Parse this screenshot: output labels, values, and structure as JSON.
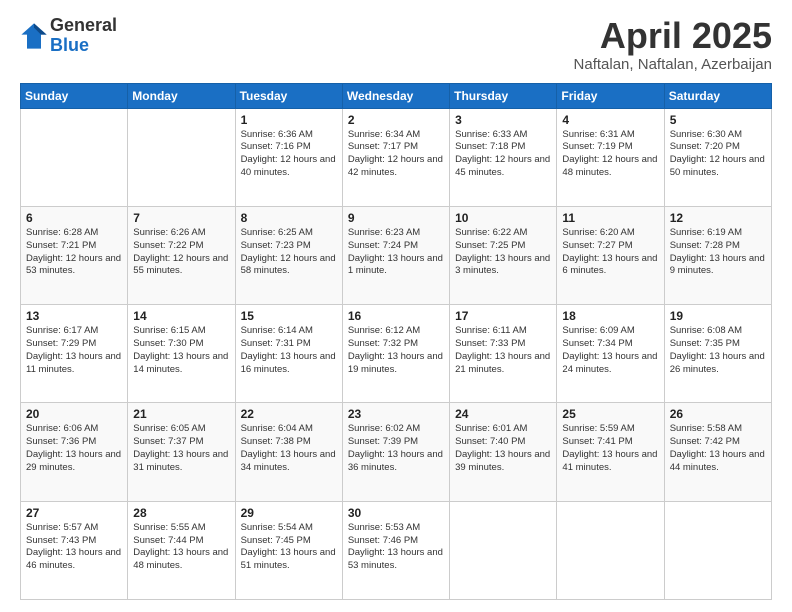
{
  "header": {
    "logo_general": "General",
    "logo_blue": "Blue",
    "month": "April 2025",
    "location": "Naftalan, Naftalan, Azerbaijan"
  },
  "weekdays": [
    "Sunday",
    "Monday",
    "Tuesday",
    "Wednesday",
    "Thursday",
    "Friday",
    "Saturday"
  ],
  "weeks": [
    [
      {
        "day": "",
        "info": ""
      },
      {
        "day": "",
        "info": ""
      },
      {
        "day": "1",
        "info": "Sunrise: 6:36 AM\nSunset: 7:16 PM\nDaylight: 12 hours and 40 minutes."
      },
      {
        "day": "2",
        "info": "Sunrise: 6:34 AM\nSunset: 7:17 PM\nDaylight: 12 hours and 42 minutes."
      },
      {
        "day": "3",
        "info": "Sunrise: 6:33 AM\nSunset: 7:18 PM\nDaylight: 12 hours and 45 minutes."
      },
      {
        "day": "4",
        "info": "Sunrise: 6:31 AM\nSunset: 7:19 PM\nDaylight: 12 hours and 48 minutes."
      },
      {
        "day": "5",
        "info": "Sunrise: 6:30 AM\nSunset: 7:20 PM\nDaylight: 12 hours and 50 minutes."
      }
    ],
    [
      {
        "day": "6",
        "info": "Sunrise: 6:28 AM\nSunset: 7:21 PM\nDaylight: 12 hours and 53 minutes."
      },
      {
        "day": "7",
        "info": "Sunrise: 6:26 AM\nSunset: 7:22 PM\nDaylight: 12 hours and 55 minutes."
      },
      {
        "day": "8",
        "info": "Sunrise: 6:25 AM\nSunset: 7:23 PM\nDaylight: 12 hours and 58 minutes."
      },
      {
        "day": "9",
        "info": "Sunrise: 6:23 AM\nSunset: 7:24 PM\nDaylight: 13 hours and 1 minute."
      },
      {
        "day": "10",
        "info": "Sunrise: 6:22 AM\nSunset: 7:25 PM\nDaylight: 13 hours and 3 minutes."
      },
      {
        "day": "11",
        "info": "Sunrise: 6:20 AM\nSunset: 7:27 PM\nDaylight: 13 hours and 6 minutes."
      },
      {
        "day": "12",
        "info": "Sunrise: 6:19 AM\nSunset: 7:28 PM\nDaylight: 13 hours and 9 minutes."
      }
    ],
    [
      {
        "day": "13",
        "info": "Sunrise: 6:17 AM\nSunset: 7:29 PM\nDaylight: 13 hours and 11 minutes."
      },
      {
        "day": "14",
        "info": "Sunrise: 6:15 AM\nSunset: 7:30 PM\nDaylight: 13 hours and 14 minutes."
      },
      {
        "day": "15",
        "info": "Sunrise: 6:14 AM\nSunset: 7:31 PM\nDaylight: 13 hours and 16 minutes."
      },
      {
        "day": "16",
        "info": "Sunrise: 6:12 AM\nSunset: 7:32 PM\nDaylight: 13 hours and 19 minutes."
      },
      {
        "day": "17",
        "info": "Sunrise: 6:11 AM\nSunset: 7:33 PM\nDaylight: 13 hours and 21 minutes."
      },
      {
        "day": "18",
        "info": "Sunrise: 6:09 AM\nSunset: 7:34 PM\nDaylight: 13 hours and 24 minutes."
      },
      {
        "day": "19",
        "info": "Sunrise: 6:08 AM\nSunset: 7:35 PM\nDaylight: 13 hours and 26 minutes."
      }
    ],
    [
      {
        "day": "20",
        "info": "Sunrise: 6:06 AM\nSunset: 7:36 PM\nDaylight: 13 hours and 29 minutes."
      },
      {
        "day": "21",
        "info": "Sunrise: 6:05 AM\nSunset: 7:37 PM\nDaylight: 13 hours and 31 minutes."
      },
      {
        "day": "22",
        "info": "Sunrise: 6:04 AM\nSunset: 7:38 PM\nDaylight: 13 hours and 34 minutes."
      },
      {
        "day": "23",
        "info": "Sunrise: 6:02 AM\nSunset: 7:39 PM\nDaylight: 13 hours and 36 minutes."
      },
      {
        "day": "24",
        "info": "Sunrise: 6:01 AM\nSunset: 7:40 PM\nDaylight: 13 hours and 39 minutes."
      },
      {
        "day": "25",
        "info": "Sunrise: 5:59 AM\nSunset: 7:41 PM\nDaylight: 13 hours and 41 minutes."
      },
      {
        "day": "26",
        "info": "Sunrise: 5:58 AM\nSunset: 7:42 PM\nDaylight: 13 hours and 44 minutes."
      }
    ],
    [
      {
        "day": "27",
        "info": "Sunrise: 5:57 AM\nSunset: 7:43 PM\nDaylight: 13 hours and 46 minutes."
      },
      {
        "day": "28",
        "info": "Sunrise: 5:55 AM\nSunset: 7:44 PM\nDaylight: 13 hours and 48 minutes."
      },
      {
        "day": "29",
        "info": "Sunrise: 5:54 AM\nSunset: 7:45 PM\nDaylight: 13 hours and 51 minutes."
      },
      {
        "day": "30",
        "info": "Sunrise: 5:53 AM\nSunset: 7:46 PM\nDaylight: 13 hours and 53 minutes."
      },
      {
        "day": "",
        "info": ""
      },
      {
        "day": "",
        "info": ""
      },
      {
        "day": "",
        "info": ""
      }
    ]
  ]
}
